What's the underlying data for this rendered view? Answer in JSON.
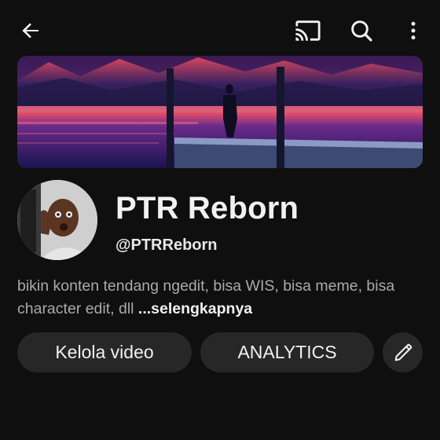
{
  "topbar": {
    "icons": [
      "arrow-left-icon",
      "cast-icon",
      "search-icon",
      "more-vertical-icon"
    ]
  },
  "banner": {
    "description_icon": "banner-image"
  },
  "channel": {
    "name": "PTR Reborn",
    "handle": "@PTRReborn",
    "description": "bikin konten tendang ngedit, bisa WIS, bisa meme, bisa character edit, dll",
    "more_label": "...selengkapnya"
  },
  "actions": {
    "manage_label": "Kelola video",
    "analytics_label": "ANALYTICS",
    "edit_icon": "pencil-icon"
  },
  "colors": {
    "background": "#0f0f0f",
    "pill": "#272727",
    "text": "#f1f1f1",
    "muted_text": "#aaaaaa"
  }
}
